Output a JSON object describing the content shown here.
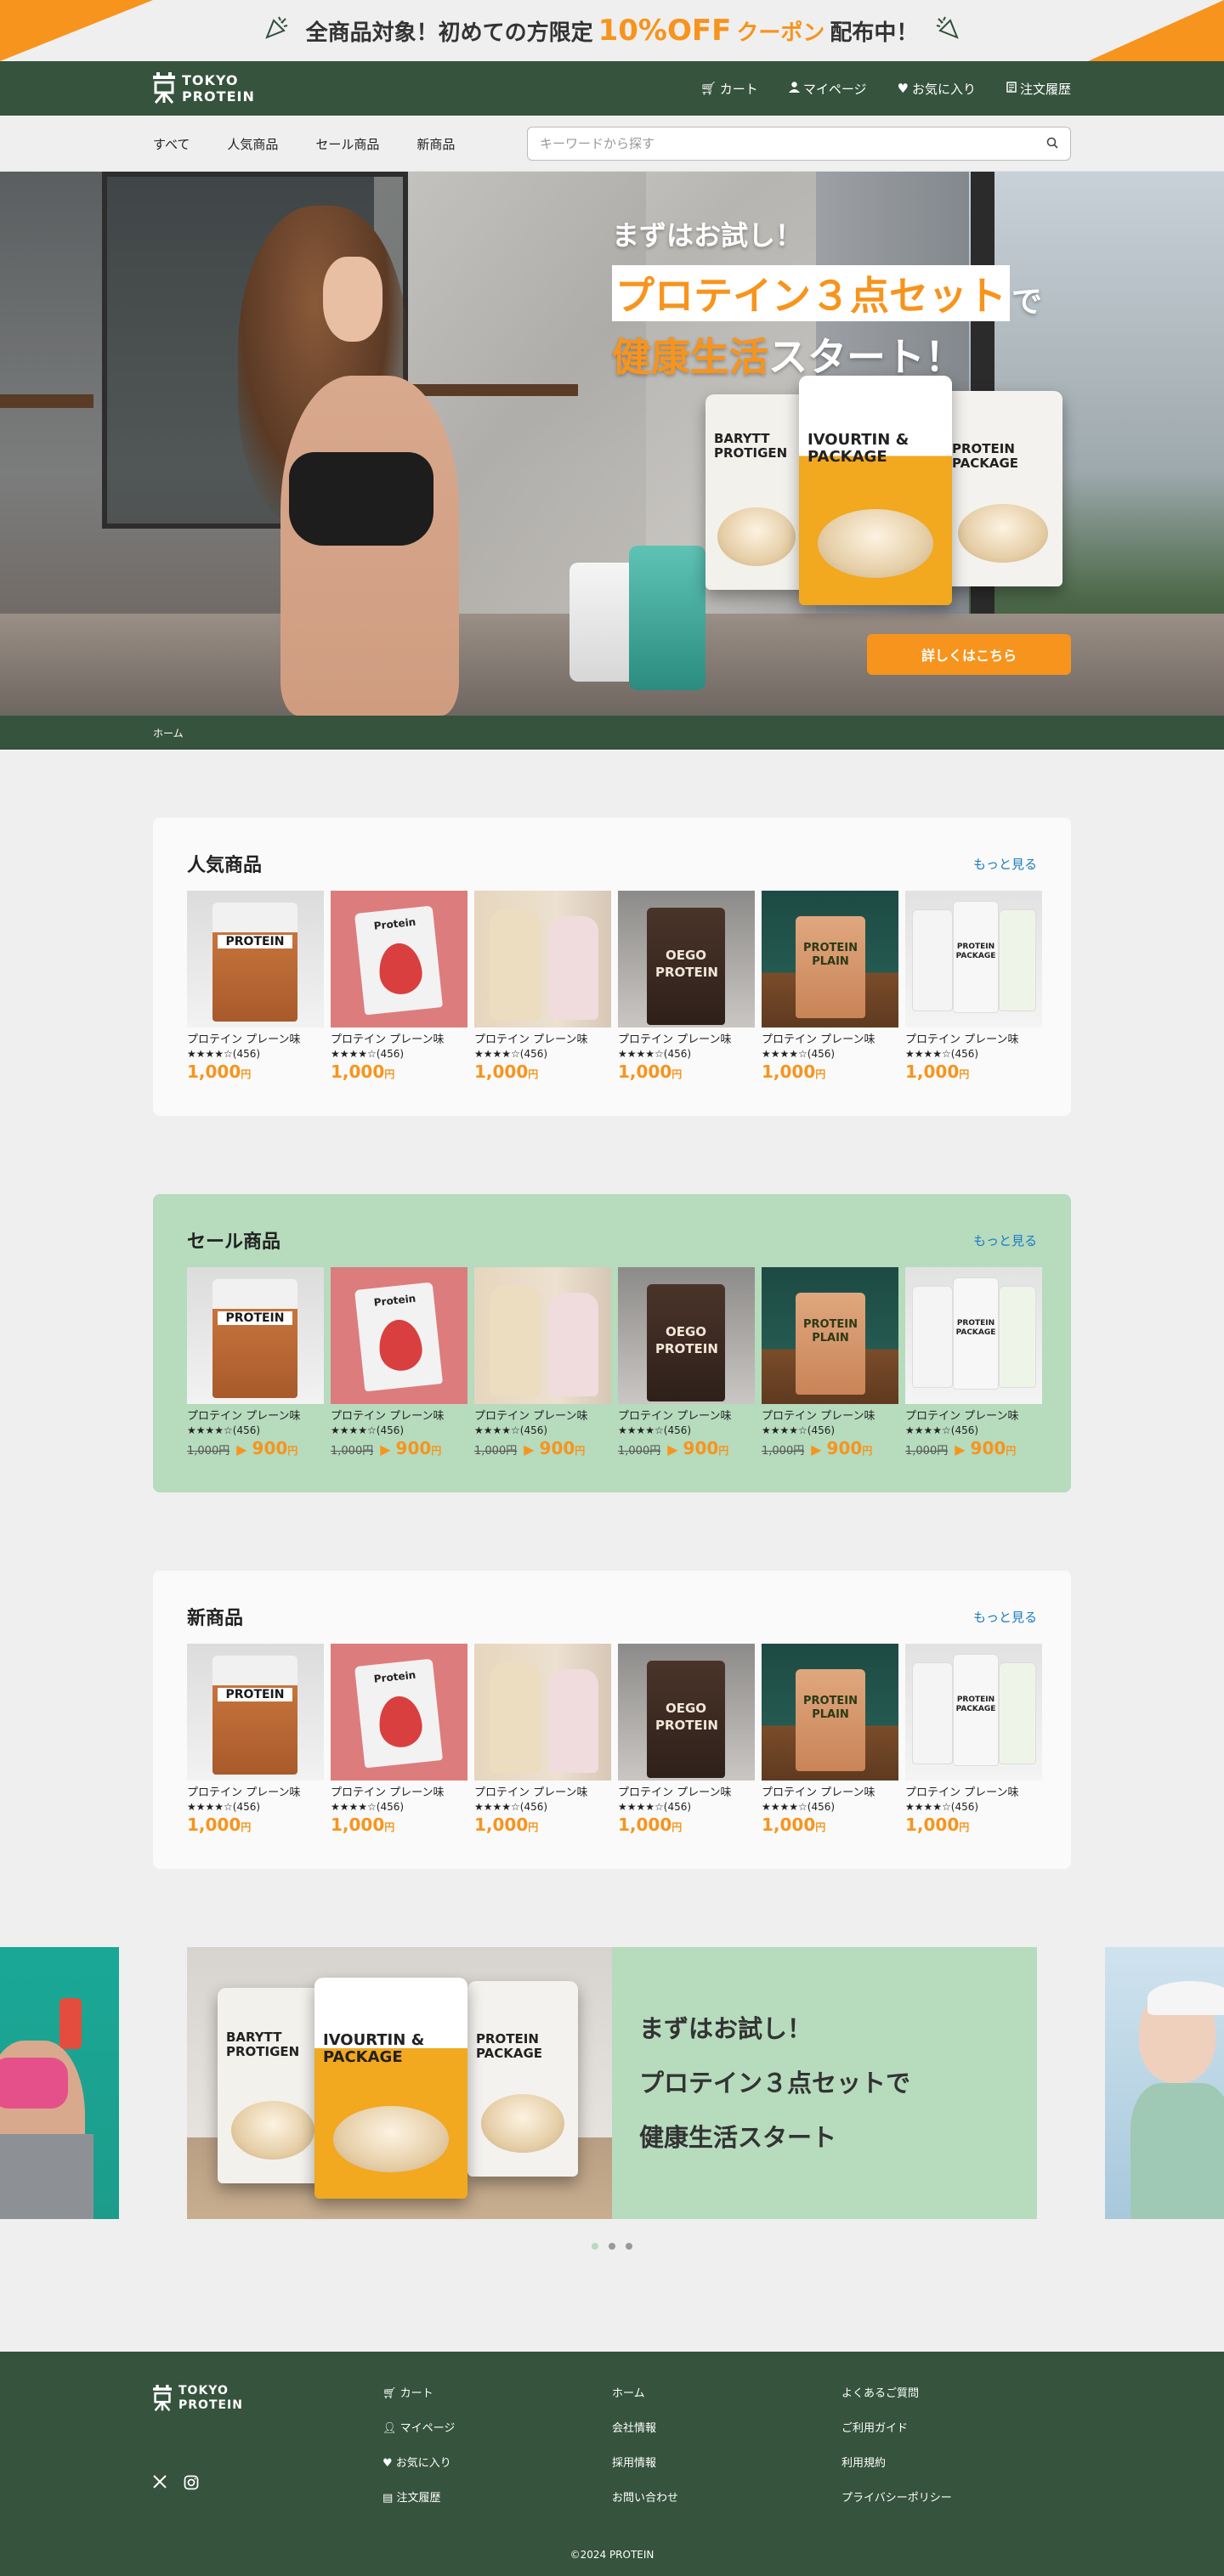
{
  "promo": {
    "pre": "全商品対象！初めての方限定",
    "percent": "10%OFF",
    "coupon": "クーポン",
    "post": "配布中！"
  },
  "header": {
    "logo_line1": "TOKYO",
    "logo_line2": "PROTEIN",
    "nav": {
      "cart": "カート",
      "mypage": "マイページ",
      "favorites": "お気に入り",
      "orders": "注文履歴"
    }
  },
  "categories": [
    "すべて",
    "人気商品",
    "セール商品",
    "新商品"
  ],
  "search": {
    "placeholder": "キーワードから探す"
  },
  "hero": {
    "line1": "まずはお試し！",
    "line2_highlight": "プロテイン３点セット",
    "line2_tail": "で",
    "line3_accent": "健康生活",
    "line3_rest": "スタート！",
    "cta": "詳しくはこちら",
    "packs": {
      "p1": "BARYTT PROTIGEN",
      "p2": "IVOURTIN & PACKAGE",
      "p3": "PROTEIN PACKAGE"
    }
  },
  "breadcrumb": {
    "home": "ホーム"
  },
  "popular": {
    "title": "人気商品",
    "more": "もっと見る",
    "items": [
      {
        "name": "プロテイン プレーン味",
        "stars": "★★★★☆",
        "reviews": "(456)",
        "price": "1,000",
        "yen": "円"
      },
      {
        "name": "プロテイン プレーン味",
        "stars": "★★★★☆",
        "reviews": "(456)",
        "price": "1,000",
        "yen": "円"
      },
      {
        "name": "プロテイン プレーン味",
        "stars": "★★★★☆",
        "reviews": "(456)",
        "price": "1,000",
        "yen": "円"
      },
      {
        "name": "プロテイン プレーン味",
        "stars": "★★★★☆",
        "reviews": "(456)",
        "price": "1,000",
        "yen": "円"
      },
      {
        "name": "プロテイン プレーン味",
        "stars": "★★★★☆",
        "reviews": "(456)",
        "price": "1,000",
        "yen": "円"
      },
      {
        "name": "プロテイン プレーン味",
        "stars": "★★★★☆",
        "reviews": "(456)",
        "price": "1,000",
        "yen": "円"
      }
    ]
  },
  "sale": {
    "title": "セール商品",
    "more": "もっと見る",
    "items": [
      {
        "name": "プロテイン プレーン味",
        "stars": "★★★★☆",
        "reviews": "(456)",
        "old": "1,000円",
        "price": "900",
        "yen": "円"
      },
      {
        "name": "プロテイン プレーン味",
        "stars": "★★★★☆",
        "reviews": "(456)",
        "old": "1,000円",
        "price": "900",
        "yen": "円"
      },
      {
        "name": "プロテイン プレーン味",
        "stars": "★★★★☆",
        "reviews": "(456)",
        "old": "1,000円",
        "price": "900",
        "yen": "円"
      },
      {
        "name": "プロテイン プレーン味",
        "stars": "★★★★☆",
        "reviews": "(456)",
        "old": "1,000円",
        "price": "900",
        "yen": "円"
      },
      {
        "name": "プロテイン プレーン味",
        "stars": "★★★★☆",
        "reviews": "(456)",
        "old": "1,000円",
        "price": "900",
        "yen": "円"
      },
      {
        "name": "プロテイン プレーン味",
        "stars": "★★★★☆",
        "reviews": "(456)",
        "old": "1,000円",
        "price": "900",
        "yen": "円"
      }
    ]
  },
  "newest": {
    "title": "新商品",
    "more": "もっと見る",
    "items": [
      {
        "name": "プロテイン プレーン味",
        "stars": "★★★★☆",
        "reviews": "(456)",
        "price": "1,000",
        "yen": "円"
      },
      {
        "name": "プロテイン プレーン味",
        "stars": "★★★★☆",
        "reviews": "(456)",
        "price": "1,000",
        "yen": "円"
      },
      {
        "name": "プロテイン プレーン味",
        "stars": "★★★★☆",
        "reviews": "(456)",
        "price": "1,000",
        "yen": "円"
      },
      {
        "name": "プロテイン プレーン味",
        "stars": "★★★★☆",
        "reviews": "(456)",
        "price": "1,000",
        "yen": "円"
      },
      {
        "name": "プロテイン プレーン味",
        "stars": "★★★★☆",
        "reviews": "(456)",
        "price": "1,000",
        "yen": "円"
      },
      {
        "name": "プロテイン プレーン味",
        "stars": "★★★★☆",
        "reviews": "(456)",
        "price": "1,000",
        "yen": "円"
      }
    ]
  },
  "thumb_labels": [
    "PROTEIN",
    "Protein",
    "",
    "OEGO PROTEIN",
    "PROTEIN PLAIN",
    "PROTEIN PACKAGE"
  ],
  "carousel": {
    "line1": "まずはお試し！",
    "line2": "プロテイン３点セットで",
    "line3": "健康生活スタート"
  },
  "footer": {
    "logo_line1": "TOKYO",
    "logo_line2": "PROTEIN",
    "col2": [
      "カート",
      "マイページ",
      "お気に入り",
      "注文履歴"
    ],
    "col3": [
      "ホーム",
      "会社情報",
      "採用情報",
      "お問い合わせ"
    ],
    "col4": [
      "よくあるご質問",
      "ご利用ガイド",
      "利用規約",
      "プライバシーポリシー"
    ],
    "copyright": "©2024 PROTEIN"
  },
  "colors": {
    "brand_green": "#35533d",
    "accent_orange": "#f7941d",
    "sale_green": "#b6dbbd",
    "link_blue": "#1a7bbf"
  },
  "icons": [
    "party-popper-icon",
    "cart-icon",
    "user-icon",
    "heart-icon",
    "receipt-icon",
    "search-icon",
    "x-twitter-icon",
    "instagram-icon"
  ]
}
